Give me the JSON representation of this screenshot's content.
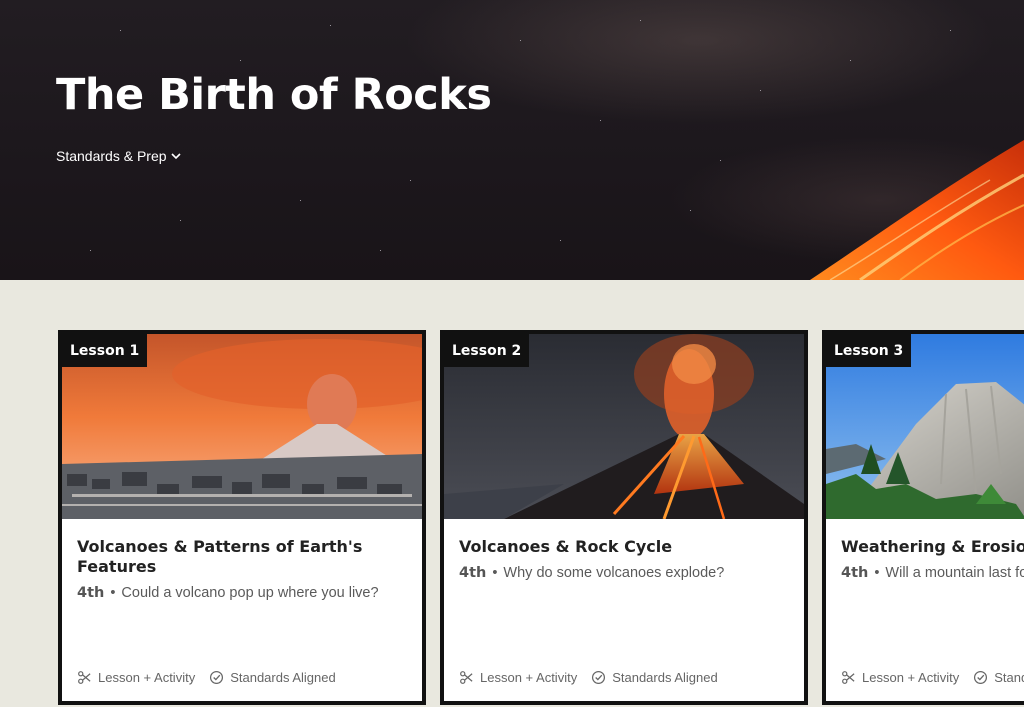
{
  "hero": {
    "title": "The Birth of Rocks",
    "standards_label": "Standards & Prep"
  },
  "cards": [
    {
      "tag": "Lesson 1",
      "title": "Volcanoes & Patterns of Earth's Features",
      "grade": "4th",
      "question": "Could a volcano pop up where you live?",
      "feature_1": "Lesson + Activity",
      "feature_2": "Standards Aligned"
    },
    {
      "tag": "Lesson 2",
      "title": "Volcanoes & Rock Cycle",
      "grade": "4th",
      "question": "Why do some volcanoes explode?",
      "feature_1": "Lesson + Activity",
      "feature_2": "Standards Aligned"
    },
    {
      "tag": "Lesson 3",
      "title": "Weathering & Erosion",
      "grade": "4th",
      "question": "Will a mountain last forever?",
      "feature_1": "Lesson + Activity",
      "feature_2": "Standards Aligned"
    }
  ],
  "icons": {
    "dropdown": "chevron-down-icon",
    "activity": "scissors-icon",
    "standards": "check-circle-icon"
  }
}
